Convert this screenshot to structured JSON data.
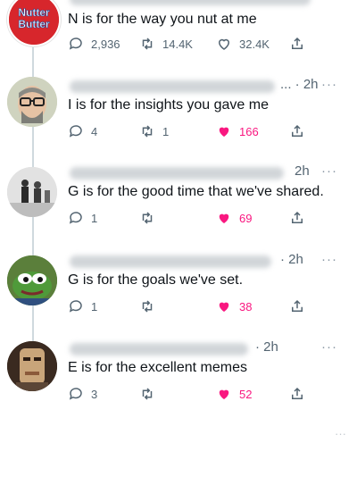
{
  "tweets": [
    {
      "avatar": "nutter-butter-logo",
      "avatar_text": "Nutter Butter",
      "time": "",
      "text": "N is for the way you nut at me",
      "reply_count": "2,936",
      "retweet_count": "14.4K",
      "like_count": "32.4K",
      "liked": false
    },
    {
      "avatar": "glasses-man-avatar",
      "time": "... · 2h",
      "text": "I is for the insights you gave me",
      "reply_count": "4",
      "retweet_count": "1",
      "like_count": "166",
      "liked": true
    },
    {
      "avatar": "vintage-photo-avatar",
      "time": "2h",
      "text": "G is for the good time that we've shared.",
      "reply_count": "1",
      "retweet_count": "",
      "like_count": "69",
      "liked": true
    },
    {
      "avatar": "pepe-frog-avatar",
      "time": "· 2h",
      "text": "G is for the goals we've set.",
      "reply_count": "1",
      "retweet_count": "",
      "like_count": "38",
      "liked": true
    },
    {
      "avatar": "character-avatar",
      "time": "· 2h",
      "text": "E is for the excellent memes",
      "reply_count": "3",
      "retweet_count": "",
      "like_count": "52",
      "liked": true
    }
  ],
  "more_label": "···",
  "colors": {
    "like": "#f91880",
    "muted": "#536471",
    "line": "#cfd9de"
  }
}
